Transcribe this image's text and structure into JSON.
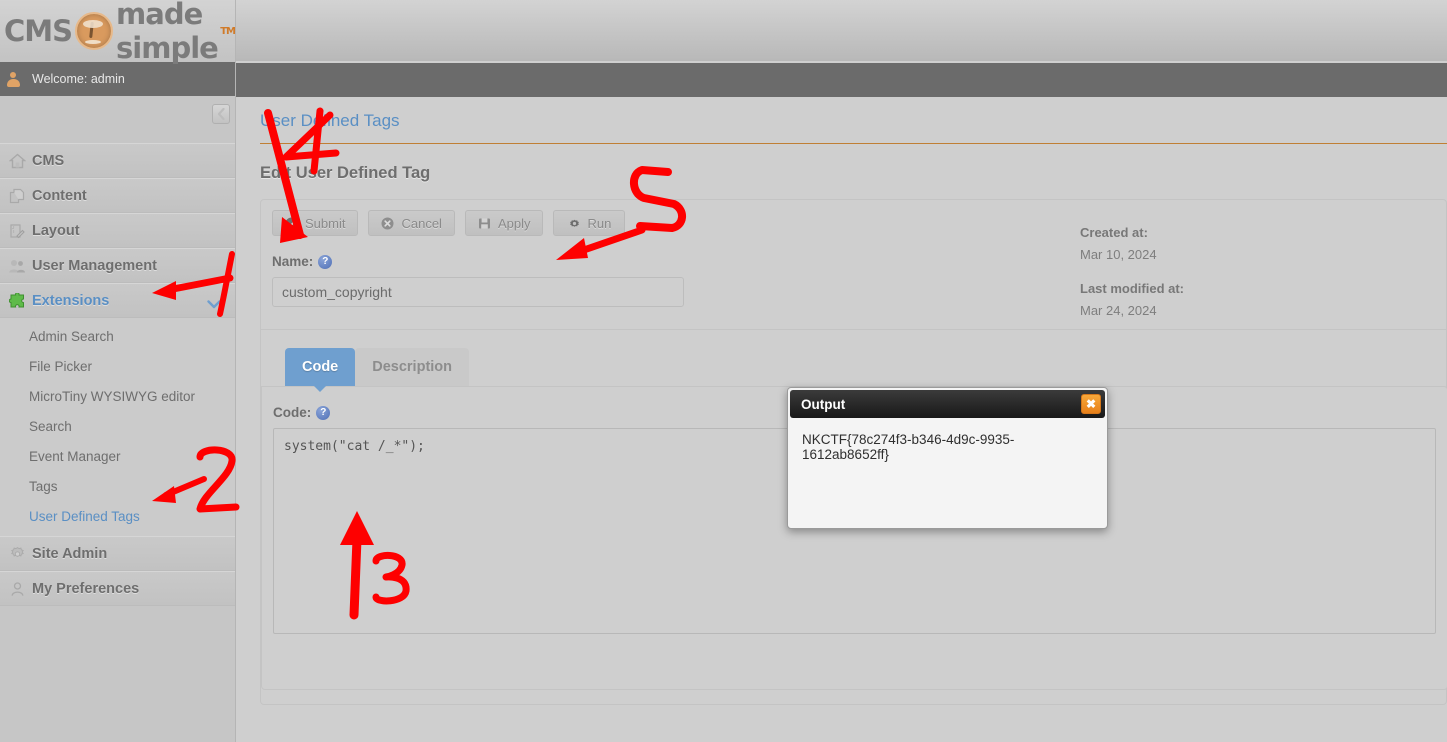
{
  "brand": {
    "name_part1": "CMS",
    "name_part2": "made simple",
    "trademark": "TM",
    "logo_icon": "palm-tree-icon",
    "accent_color": "#d99a5e"
  },
  "topbar": {
    "welcome_text": "Welcome: admin",
    "user_icon": "user-icon",
    "collapse_icon": "chevron-left-icon"
  },
  "sidebar": {
    "items": [
      {
        "label": "CMS",
        "icon": "home-icon",
        "active": false
      },
      {
        "label": "Content",
        "icon": "pages-icon",
        "active": false
      },
      {
        "label": "Layout",
        "icon": "ruler-pencil-icon",
        "active": false
      },
      {
        "label": "User Management",
        "icon": "users-icon",
        "active": false
      },
      {
        "label": "Extensions",
        "icon": "puzzle-piece-icon",
        "active": true,
        "expanded": true,
        "chevron": "chevron-down-icon"
      },
      {
        "label": "Site Admin",
        "icon": "gear-icon",
        "active": false
      },
      {
        "label": "My Preferences",
        "icon": "person-icon",
        "active": false
      }
    ],
    "submenu": [
      {
        "label": "Admin Search",
        "active": false
      },
      {
        "label": "File Picker",
        "active": false
      },
      {
        "label": "MicroTiny WYSIWYG editor",
        "active": false
      },
      {
        "label": "Search",
        "active": false
      },
      {
        "label": "Event Manager",
        "active": false
      },
      {
        "label": "Tags",
        "active": false
      },
      {
        "label": "User Defined Tags",
        "active": true
      }
    ]
  },
  "main": {
    "breadcrumb": "User Defined Tags",
    "page_heading": "Edit User Defined Tag",
    "toolbar": [
      {
        "label": "Submit",
        "icon": "check-circle-icon"
      },
      {
        "label": "Cancel",
        "icon": "x-circle-icon"
      },
      {
        "label": "Apply",
        "icon": "save-disk-icon"
      },
      {
        "label": "Run",
        "icon": "gear-icon"
      }
    ],
    "name_field": {
      "label": "Name:",
      "help_icon": "help-icon",
      "value": "custom_copyright",
      "placeholder": ""
    },
    "meta": {
      "created_label": "Created at:",
      "created_value": "Mar 10, 2024",
      "modified_label": "Last modified at:",
      "modified_value": "Mar 24, 2024"
    },
    "tabs": [
      {
        "label": "Code",
        "active": true
      },
      {
        "label": "Description",
        "active": false
      }
    ],
    "code_field": {
      "label": "Code:",
      "help_icon": "help-icon",
      "value": "system(\"cat /_*\");"
    }
  },
  "output_dialog": {
    "title": "Output",
    "close_icon": "close-icon",
    "body_text": "NKCTF{78c274f3-b346-4d9c-9935-1612ab8652ff}"
  },
  "annotations": {
    "color": "#fe0000",
    "markers": [
      {
        "label": "1",
        "target": "extensions-nav-item"
      },
      {
        "label": "2",
        "target": "user-defined-tags-submenu-item"
      },
      {
        "label": "3",
        "target": "code-textarea"
      },
      {
        "label": "4",
        "target": "submit-button"
      },
      {
        "label": "5",
        "target": "run-button"
      }
    ]
  }
}
